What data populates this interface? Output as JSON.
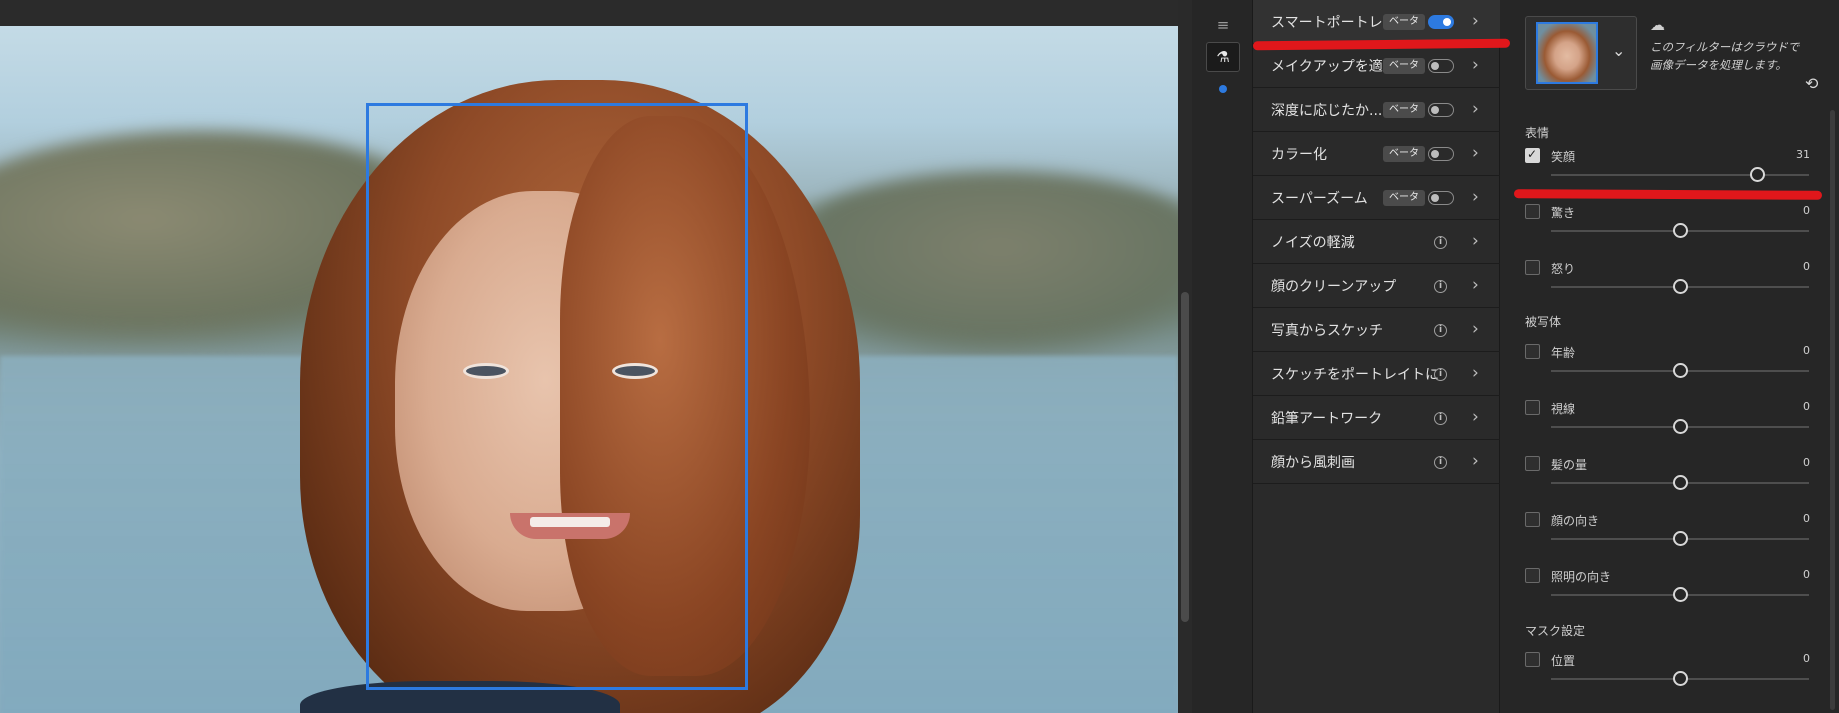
{
  "filters": [
    {
      "name": "スマートポートレイト",
      "badge": "ベータ",
      "control": "toggle-on",
      "selected": true
    },
    {
      "name": "メイクアップを適用",
      "badge": "ベータ",
      "control": "toggle-off"
    },
    {
      "name": "深度に応じたか...",
      "badge": "ベータ",
      "control": "toggle-off"
    },
    {
      "name": "カラー化",
      "badge": "ベータ",
      "control": "toggle-off"
    },
    {
      "name": "スーパーズーム",
      "badge": "ベータ",
      "control": "toggle-off"
    },
    {
      "name": "ノイズの軽減",
      "control": "info"
    },
    {
      "name": "顔のクリーンアップ",
      "control": "info"
    },
    {
      "name": "写真からスケッチ",
      "control": "info"
    },
    {
      "name": "スケッチをポートレイトに",
      "control": "info"
    },
    {
      "name": "鉛筆アートワーク",
      "control": "info"
    },
    {
      "name": "顔から風刺画",
      "control": "info"
    }
  ],
  "icons": {
    "info": "ⓘ",
    "chevron": "›",
    "chevron_down": "⌄",
    "cloud": "☁",
    "reset": "⟲",
    "sliders": "≡",
    "flask": "⚗"
  },
  "settings": {
    "cloud_note": "このフィルターはクラウドで画像データを処理します。",
    "sections": [
      {
        "title": "表情",
        "items": [
          {
            "label": "笑顔",
            "value": "31",
            "checked": true,
            "level": 0.8
          },
          {
            "label": "驚き",
            "value": "0",
            "checked": false,
            "level": 0.5
          },
          {
            "label": "怒り",
            "value": "0",
            "checked": false,
            "level": 0.5
          }
        ]
      },
      {
        "title": "被写体",
        "items": [
          {
            "label": "年齢",
            "value": "0",
            "checked": false,
            "level": 0.5
          },
          {
            "label": "視線",
            "value": "0",
            "checked": false,
            "level": 0.5
          },
          {
            "label": "髪の量",
            "value": "0",
            "checked": false,
            "level": 0.5
          },
          {
            "label": "顔の向き",
            "value": "0",
            "checked": false,
            "level": 0.5
          },
          {
            "label": "照明の向き",
            "value": "0",
            "checked": false,
            "level": 0.5
          }
        ]
      },
      {
        "title": "マスク設定",
        "items": [
          {
            "label": "位置",
            "value": "0",
            "checked": false,
            "level": 0.5
          }
        ]
      }
    ]
  },
  "colors": {
    "accent": "#2d7ae0",
    "annotation_red": "#e0171b"
  }
}
